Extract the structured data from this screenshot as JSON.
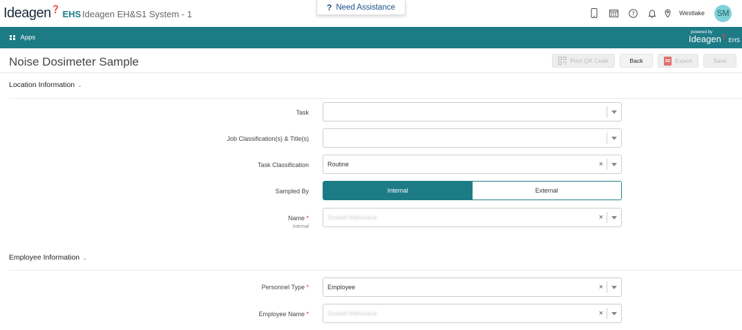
{
  "header": {
    "logo_text": "Ideagen",
    "logo_suffix": "EHS",
    "app_title": "Ideagen EH&S1 System - 1",
    "assist_label": "Need Assistance",
    "location": "Westlake",
    "avatar_initials": "SM",
    "icons": [
      "mobile-icon",
      "calendar-icon",
      "help-icon",
      "bell-icon",
      "location-pin-icon"
    ]
  },
  "navbar": {
    "apps_label": "Apps",
    "powered_by": "powered by",
    "brand": "Ideagen",
    "brand_suffix": "EHS"
  },
  "page": {
    "title": "Noise Dosimeter Sample",
    "buttons": {
      "print_qr": "Print QR Code",
      "back": "Back",
      "export": "Export",
      "save": "Save"
    }
  },
  "location_section": {
    "title": "Location Information",
    "fields": {
      "task_label": "Task",
      "task_value": "",
      "job_label": "Job Classification(s) & Title(s)",
      "job_value": "",
      "task_class_label": "Task Classification",
      "task_class_value": "Routine",
      "sampled_by_label": "Sampled By",
      "sampled_by_options": [
        "Internal",
        "External"
      ],
      "sampled_by_selected": "Internal",
      "name_label": "Name",
      "name_sublabel": "Internal",
      "name_value": "Suneel Mahorana"
    }
  },
  "employee_section": {
    "title": "Employee Information",
    "fields": {
      "personnel_type_label": "Personnel Type",
      "personnel_type_value": "Employee",
      "employee_name_label": "Employee Name",
      "employee_name_value": "Suneel Mahorana"
    }
  },
  "colors": {
    "brand_teal": "#1d7b86",
    "logo_accent": "#d6246e",
    "required": "#c0392b"
  }
}
